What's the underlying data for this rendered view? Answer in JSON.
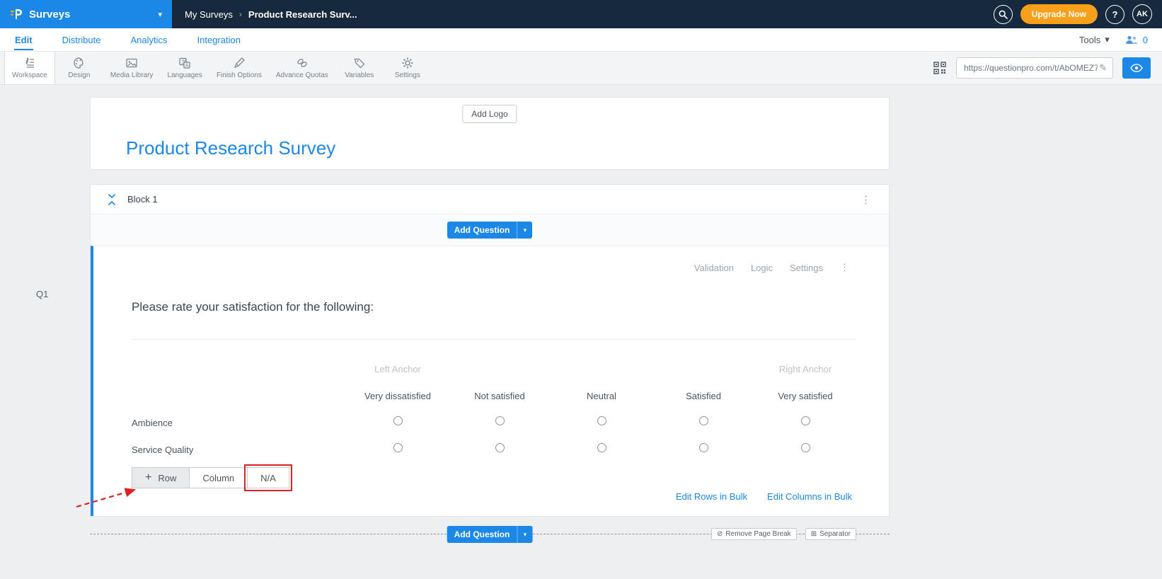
{
  "topbar": {
    "app": "Surveys",
    "breadcrumb": {
      "parent": "My Surveys",
      "current": "Product Research Surv..."
    },
    "upgrade": "Upgrade Now",
    "help": "?",
    "avatar": "AK"
  },
  "nav": {
    "tabs": [
      {
        "label": "Edit"
      },
      {
        "label": "Distribute"
      },
      {
        "label": "Analytics"
      },
      {
        "label": "Integration"
      }
    ],
    "tools": "Tools",
    "collab_count": "0"
  },
  "toolbar": {
    "items": [
      {
        "label": "Workspace"
      },
      {
        "label": "Design"
      },
      {
        "label": "Media Library"
      },
      {
        "label": "Languages"
      },
      {
        "label": "Finish Options"
      },
      {
        "label": "Advance Quotas"
      },
      {
        "label": "Variables"
      },
      {
        "label": "Settings"
      }
    ],
    "url": "https://questionpro.com/t/AbOMEZ7"
  },
  "survey": {
    "add_logo": "Add Logo",
    "title": "Product Research Survey"
  },
  "block": {
    "title": "Block 1",
    "add_question": "Add Question"
  },
  "question": {
    "id": "Q1",
    "menu": {
      "validation": "Validation",
      "logic": "Logic",
      "settings": "Settings"
    },
    "text": "Please rate your satisfaction for the following:",
    "anchors": {
      "left": "Left Anchor",
      "right": "Right Anchor"
    },
    "columns": [
      "Very dissatisfied",
      "Not satisfied",
      "Neutral",
      "Satisfied",
      "Very satisfied"
    ],
    "rows": [
      "Ambience",
      "Service Quality"
    ],
    "controls": {
      "row": "Row",
      "column": "Column",
      "na": "N/A"
    },
    "bulk": {
      "rows": "Edit Rows in Bulk",
      "columns": "Edit Columns in Bulk"
    }
  },
  "pagebreak": {
    "add_question": "Add Question",
    "remove": "Remove Page Break",
    "separator": "Separator"
  },
  "icons": {
    "caret_down": "▾",
    "kebab": "⋮",
    "plus": "+",
    "pencil": "✎",
    "breadcrumb_sep": "›",
    "remove_pb": "⊘",
    "separator_glyph": "⊞"
  },
  "colors": {
    "accent": "#1b87e6",
    "upgrade": "#f9a01b",
    "alert": "#e02020",
    "header": "#17293c"
  }
}
